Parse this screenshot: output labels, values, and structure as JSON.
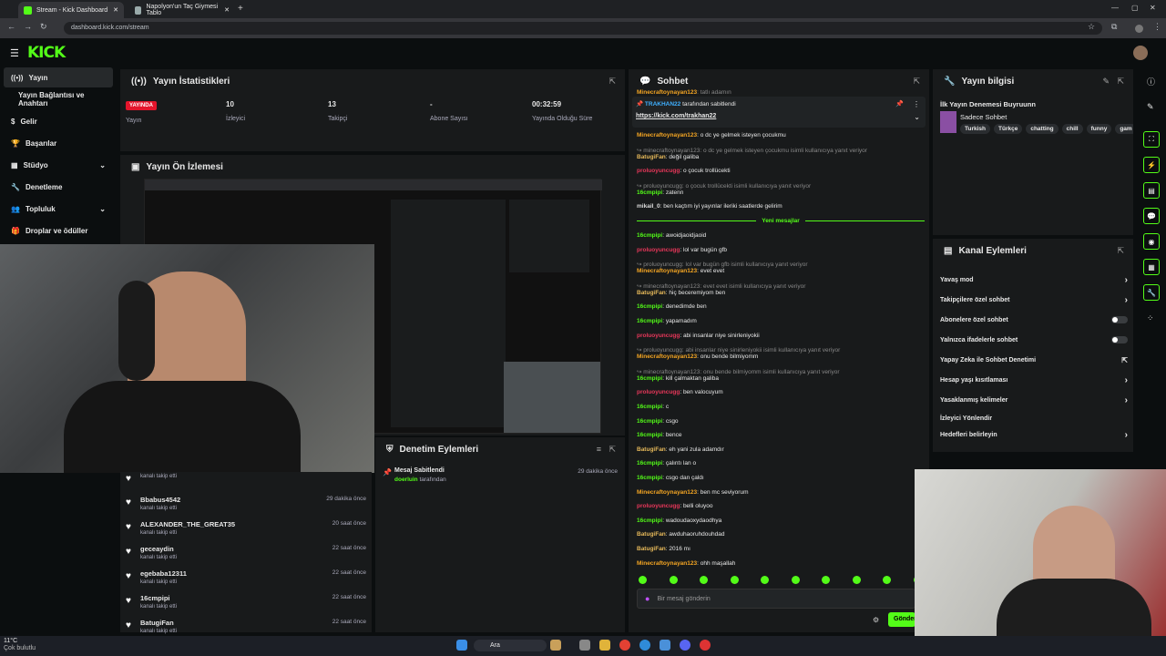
{
  "browser": {
    "tabs": [
      {
        "title": "Stream - Kick Dashboard"
      },
      {
        "title": "Napolyon'un Taç Giymesi Tablo"
      }
    ],
    "url": "dashboard.kick.com/stream"
  },
  "app": {
    "logo": "KICK"
  },
  "sidebar": {
    "items": [
      {
        "label": "Yayın",
        "icon": "broadcast-icon",
        "active": true
      },
      {
        "label": "Yayın Bağlantısı ve Anahtarı"
      },
      {
        "label": "Gelir",
        "icon": "dollar-icon"
      },
      {
        "label": "Başarılar",
        "icon": "trophy-icon"
      },
      {
        "label": "Stüdyo",
        "icon": "studio-icon"
      },
      {
        "label": "Denetleme",
        "icon": "wrench-icon"
      },
      {
        "label": "Topluluk",
        "icon": "users-icon"
      },
      {
        "label": "Droplar ve ödüller",
        "icon": "gift-icon"
      }
    ]
  },
  "stats": {
    "title": "Yayın İstatistikleri",
    "badge": "YAYINDA",
    "items": [
      {
        "value": "",
        "label": "Yayın"
      },
      {
        "value": "10",
        "label": "İzleyici"
      },
      {
        "value": "13",
        "label": "Takipçi"
      },
      {
        "value": "-",
        "label": "Abone Sayısı"
      },
      {
        "value": "00:32:59",
        "label": "Yayında Olduğu Süre"
      }
    ]
  },
  "preview": {
    "title": "Yayın Ön İzlemesi"
  },
  "followers": [
    {
      "name": "",
      "sub": "kanalı takip etti",
      "time": ""
    },
    {
      "name": "Bbabus4542",
      "sub": "kanalı takip etti",
      "time": "29 dakika önce"
    },
    {
      "name": "ALEXANDER_THE_GREAT35",
      "sub": "kanalı takip etti",
      "time": "20 saat önce"
    },
    {
      "name": "geceaydin",
      "sub": "kanalı takip etti",
      "time": "22 saat önce"
    },
    {
      "name": "egebaba12311",
      "sub": "kanalı takip etti",
      "time": "22 saat önce"
    },
    {
      "name": "16cmpipi",
      "sub": "kanalı takip etti",
      "time": "22 saat önce"
    },
    {
      "name": "BatugiFan",
      "sub": "kanalı takip etti",
      "time": "22 saat önce"
    }
  ],
  "moderation": {
    "title": "Denetim Eylemleri",
    "item_title": "Mesaj Sabitlendi",
    "item_user": "doerluin",
    "item_suffix": "tarafından",
    "item_time": "29 dakika önce"
  },
  "chat": {
    "title": "Sohbet",
    "top_line": {
      "user": "Minecraftoynayan123",
      "text": "tatlı adamın"
    },
    "pinned": {
      "user": "TRAKHAN22",
      "suffix": "tarafından sabitlendi",
      "link": "https://kick.com/trakhan22"
    },
    "new_messages": "Yeni mesajlar",
    "placeholder": "Bir mesaj gönderin",
    "send": "Gönder",
    "messages": [
      {
        "user": "Minecraftoynayan123",
        "text": "o dc ye gelmek isteyen çocukmu",
        "color": "o"
      },
      {
        "reply": "↪ minecraftoynayan123: o dc ye gelmek isteyen çocukmu isimli kullanıcıya yanıt veriyor"
      },
      {
        "user": "BatugiFan",
        "text": "değil galiba",
        "color": "b"
      },
      {
        "user": "proluoyuncugg",
        "text": "o çocuk trollücekti",
        "color": "r"
      },
      {
        "reply": "↪ proluoyuncugg: o çocuk trollücekti isimli kullanıcıya yanıt veriyor"
      },
      {
        "user": "16cmpipi",
        "text": "zatenn",
        "color": "g"
      },
      {
        "user": "mikail_0",
        "text": "ben kaçtım iyi yayınlar ileriki saatlerde gelirim",
        "color": "w"
      },
      {
        "divider": true
      },
      {
        "user": "16cmpipi",
        "text": "awoidjaoidjaoid",
        "color": "g"
      },
      {
        "user": "proluoyuncugg",
        "text": "lol var bugün gfb",
        "color": "r"
      },
      {
        "reply": "↪ proluoyuncugg: lol var bugün gfb isimli kullanıcıya yanıt veriyor"
      },
      {
        "user": "Minecraftoynayan123",
        "text": "evet evet",
        "color": "o"
      },
      {
        "reply": "↪ minecraftoynayan123: evet evet isimli kullanıcıya yanıt veriyor"
      },
      {
        "user": "BatugiFan",
        "text": "hiç beceremiyom ben",
        "color": "b"
      },
      {
        "user": "16cmpipi",
        "text": "denedimde ben",
        "color": "g"
      },
      {
        "user": "16cmpipi",
        "text": "yapamadım",
        "color": "g"
      },
      {
        "user": "proluoyuncugg",
        "text": "abi insanlar niye sinirleniyokii",
        "color": "r"
      },
      {
        "reply": "↪ proluoyuncugg: abi insanlar niye sinirleniyokii isimli kullanıcıya yanıt veriyor"
      },
      {
        "user": "Minecraftoynayan123",
        "text": "onu bende bilmiyomm",
        "color": "o"
      },
      {
        "reply": "↪ minecraftoynayan123: onu bende bilmiyomm isimli kullanıcıya yanıt veriyor"
      },
      {
        "user": "16cmpipi",
        "text": "kill çalmaktan galiba",
        "color": "g"
      },
      {
        "user": "proluoyuncugg",
        "text": "ben valocuyum",
        "color": "r"
      },
      {
        "user": "16cmpipi",
        "text": "c",
        "color": "g"
      },
      {
        "user": "16cmpipi",
        "text": "csgo",
        "color": "g"
      },
      {
        "user": "16cmpipi",
        "text": "bence",
        "color": "g"
      },
      {
        "user": "BatugiFan",
        "text": "eh yani zula adamdır",
        "color": "b"
      },
      {
        "user": "16cmpipi",
        "text": "çalıntı lan o",
        "color": "g"
      },
      {
        "user": "16cmpipi",
        "text": "csgo dan çaldı",
        "color": "g"
      },
      {
        "user": "Minecraftoynayan123",
        "text": "ben mc seviyorum",
        "color": "o"
      },
      {
        "user": "proluoyuncugg",
        "text": "belli oluyoo",
        "color": "r"
      },
      {
        "user": "16cmpipi",
        "text": "wadoudaoxydaodhya",
        "color": "g"
      },
      {
        "user": "BatugiFan",
        "text": "awduhaoruhdouhdad",
        "color": "b"
      },
      {
        "user": "BatugiFan",
        "text": "2016 mı",
        "color": "b"
      },
      {
        "user": "Minecraftoynayan123",
        "text": "ohh maşallah",
        "color": "o"
      }
    ]
  },
  "stream_info": {
    "title": "Yayın bilgisi",
    "stream_title": "İlk Yayın Denemesi Buyruunn",
    "category": "Sadece Sohbet",
    "tags": [
      "Turkish",
      "Türkçe",
      "chatting",
      "chill",
      "funny",
      "gam"
    ]
  },
  "channel_actions": {
    "title": "Kanal Eylemleri",
    "items": [
      {
        "label": "Yavaş mod",
        "control": "chevron"
      },
      {
        "label": "Takipçilere özel sohbet",
        "control": "chevron"
      },
      {
        "label": "Abonelere özel sohbet",
        "control": "toggle"
      },
      {
        "label": "Yalnızca ifadelerle sohbet",
        "control": "toggle"
      },
      {
        "label": "Yapay Zeka ile Sohbet Denetimi",
        "control": "external"
      },
      {
        "label": "Hesap yaşı kısıtlaması",
        "control": "chevron"
      },
      {
        "label": "Yasaklanmış kelimeler",
        "control": "chevron"
      },
      {
        "label": "İzleyici Yönlendir",
        "control": "none"
      },
      {
        "label": "Hedefleri belirleyin",
        "control": "chevron"
      }
    ]
  },
  "taskbar": {
    "search": "Ara",
    "weather_temp": "11°C",
    "weather_text": "Çok bulutlu"
  },
  "colors": {
    "accent": "#53fc18",
    "live": "#e4142b",
    "panel": "#181a1b",
    "bg": "#0b0e0f"
  }
}
